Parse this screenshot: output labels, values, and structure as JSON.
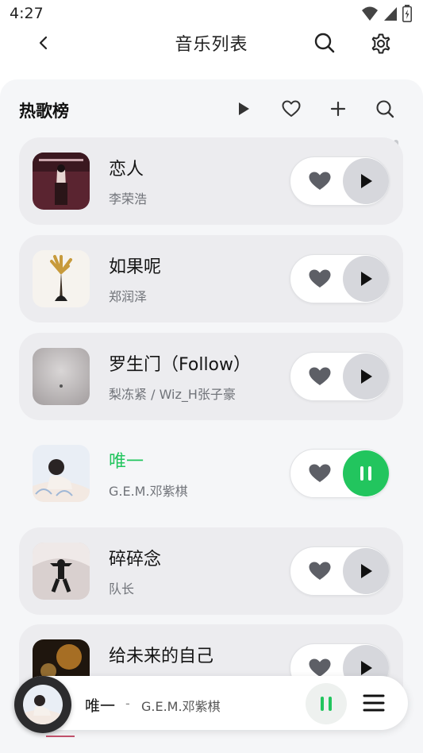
{
  "status_bar": {
    "time": "4:27"
  },
  "header": {
    "title": "音乐列表"
  },
  "section": {
    "title": "热歌榜"
  },
  "songs": [
    {
      "title": "恋人",
      "artist": "李荣浩",
      "state": "paused"
    },
    {
      "title": "如果呢",
      "artist": "郑润泽",
      "state": "paused"
    },
    {
      "title": "罗生门（Follow）",
      "artist": "梨冻紧 / Wiz_H张子豪",
      "state": "paused"
    },
    {
      "title": "唯一",
      "artist": "G.E.M.邓紫棋",
      "state": "playing"
    },
    {
      "title": "碎碎念",
      "artist": "队长",
      "state": "paused"
    },
    {
      "title": "给未来的自己",
      "artist": "",
      "state": "paused"
    }
  ],
  "now_playing": {
    "title": "唯一",
    "separator": "-",
    "artist": "G.E.M.邓紫棋"
  },
  "colors": {
    "accent": "#22c55e",
    "panel": "#f5f6f8",
    "card": "#ececef"
  }
}
